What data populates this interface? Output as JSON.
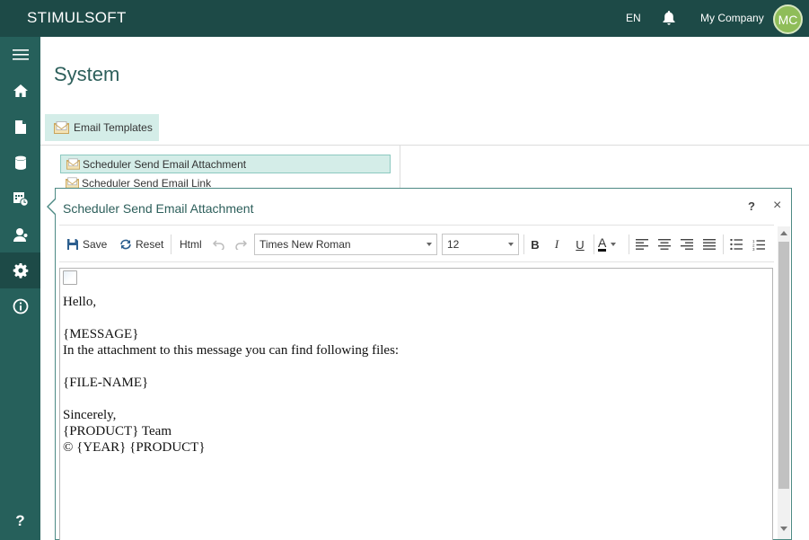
{
  "app": {
    "brand": "STIMULSOFT",
    "language": "EN",
    "company": "My Company",
    "avatar_initials": "MC"
  },
  "colors": {
    "topbar": "#1d4a47",
    "sidebar": "#26605b",
    "accent": "#2d5f5b",
    "selection": "#d4ede8",
    "avatar": "#8fbd59"
  },
  "sidebar": {
    "items": [
      {
        "icon": "menu-icon"
      },
      {
        "icon": "home-icon"
      },
      {
        "icon": "document-icon"
      },
      {
        "icon": "database-icon"
      },
      {
        "icon": "scheduler-icon"
      },
      {
        "icon": "users-icon"
      },
      {
        "icon": "gear-icon",
        "active": true
      },
      {
        "icon": "info-icon"
      }
    ],
    "help_label": "?"
  },
  "page": {
    "title": "System",
    "tab_label": "Email Templates"
  },
  "tree": {
    "items": [
      {
        "label": "Scheduler Send Email Attachment",
        "selected": true
      },
      {
        "label": "Scheduler Send Email Link",
        "selected": false
      }
    ]
  },
  "dialog": {
    "title": "Scheduler Send Email Attachment",
    "help": "?",
    "close": "×",
    "toolbar": {
      "save_label": "Save",
      "reset_label": "Reset",
      "html_label": "Html",
      "font_family": "Times New Roman",
      "font_size": "12",
      "bold": "B",
      "italic": "I",
      "underline": "U",
      "font_color": "A"
    },
    "body_lines": [
      "Hello,",
      "",
      "{MESSAGE}",
      "In the attachment to this message you can find following files:",
      "",
      "{FILE-NAME}",
      "",
      "Sincerely,",
      "{PRODUCT} Team",
      "© {YEAR} {PRODUCT}"
    ]
  }
}
